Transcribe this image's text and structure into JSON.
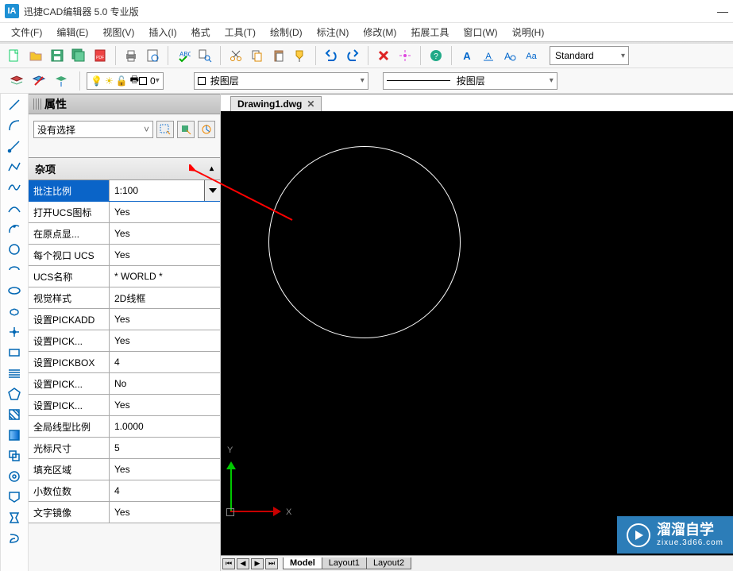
{
  "app": {
    "title": "迅捷CAD编辑器 5.0 专业版",
    "logo_text": "IA"
  },
  "menu": [
    "文件(F)",
    "编辑(E)",
    "视图(V)",
    "插入(I)",
    "格式",
    "工具(T)",
    "绘制(D)",
    "标注(N)",
    "修改(M)",
    "拓展工具",
    "窗口(W)",
    "说明(H)"
  ],
  "style_dropdown": "Standard",
  "layer_row": {
    "current_layer_name_display": "0",
    "bylayer_label": "按图层",
    "byline_label": "按图层"
  },
  "panel": {
    "title": "属性",
    "selection": "没有选择",
    "category": "杂项",
    "rows": [
      {
        "key": "批注比例",
        "val": "1:100",
        "selected": true
      },
      {
        "key": "打开UCS图标",
        "val": "Yes"
      },
      {
        "key": "在原点显...",
        "val": "Yes"
      },
      {
        "key": "每个视口 UCS",
        "val": "Yes"
      },
      {
        "key": "UCS名称",
        "val": "* WORLD *"
      },
      {
        "key": "视觉样式",
        "val": "2D线框"
      },
      {
        "key": "设置PICKADD",
        "val": "Yes"
      },
      {
        "key": "设置PICK...",
        "val": "Yes"
      },
      {
        "key": "设置PICKBOX",
        "val": "4"
      },
      {
        "key": "设置PICK...",
        "val": "No"
      },
      {
        "key": "设置PICK...",
        "val": "Yes"
      },
      {
        "key": "全局线型比例",
        "val": "1.0000"
      },
      {
        "key": "光标尺寸",
        "val": "5"
      },
      {
        "key": "填充区域",
        "val": "Yes"
      },
      {
        "key": "小数位数",
        "val": "4"
      },
      {
        "key": "文字镜像",
        "val": "Yes"
      }
    ]
  },
  "document": {
    "tab_name": "Drawing1.dwg",
    "axis_y": "Y",
    "axis_x": "X"
  },
  "layout_tabs": {
    "model": "Model",
    "layout1": "Layout1",
    "layout2": "Layout2"
  },
  "watermark": {
    "title": "溜溜自学",
    "sub": "zixue.3d66.com"
  }
}
